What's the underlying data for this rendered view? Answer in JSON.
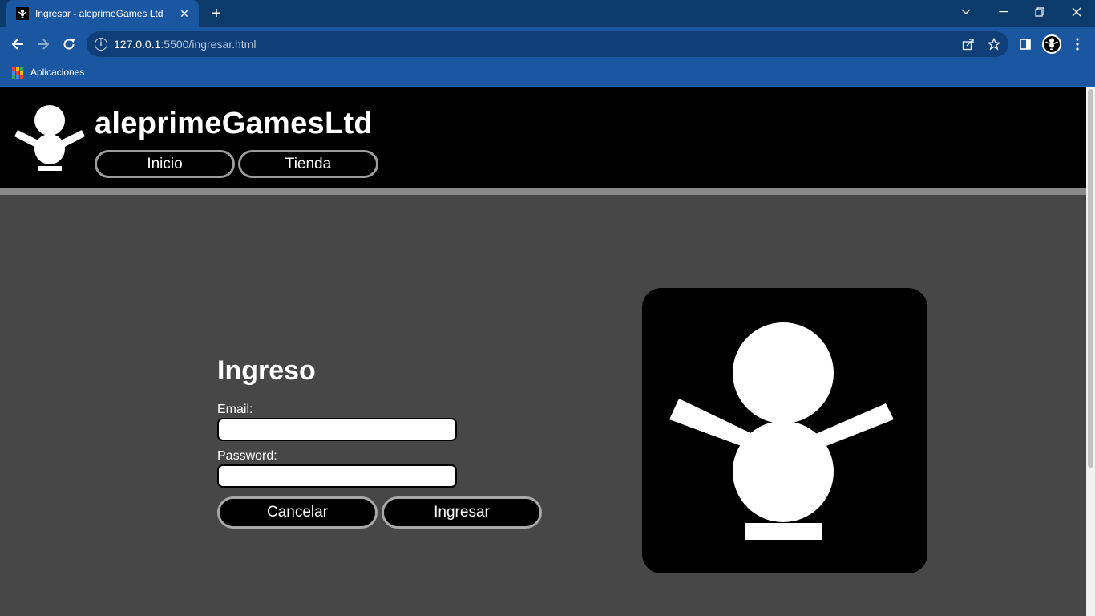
{
  "browser": {
    "tab_title": "Ingresar - aleprimeGames Ltd",
    "url_host": "127.0.0.1",
    "url_rest": ":5500/ingresar.html",
    "bookmarks_apps_label": "Aplicaciones"
  },
  "site": {
    "brand": "aleprimeGamesLtd",
    "nav": {
      "inicio": "Inicio",
      "tienda": "Tienda"
    }
  },
  "login": {
    "title": "Ingreso",
    "email_label": "Email:",
    "email_value": "",
    "password_label": "Password:",
    "password_value": "",
    "cancel_label": "Cancelar",
    "submit_label": "Ingresar"
  },
  "colors": {
    "chrome_dark": "#0b3a6b",
    "chrome": "#1b56a1",
    "header_bg": "#000000",
    "page_bg": "#474747",
    "button_border": "#a8a8a8"
  },
  "icons": {
    "favicon": "robot-figure-icon",
    "back": "arrow-left-icon",
    "forward": "arrow-right-icon",
    "reload": "reload-icon",
    "info": "info-icon",
    "share": "share-icon",
    "bookmark": "star-icon",
    "side_panel": "side-panel-icon",
    "profile": "avatar",
    "menu": "kebab-menu-icon",
    "apps": "apps-grid-icon"
  }
}
